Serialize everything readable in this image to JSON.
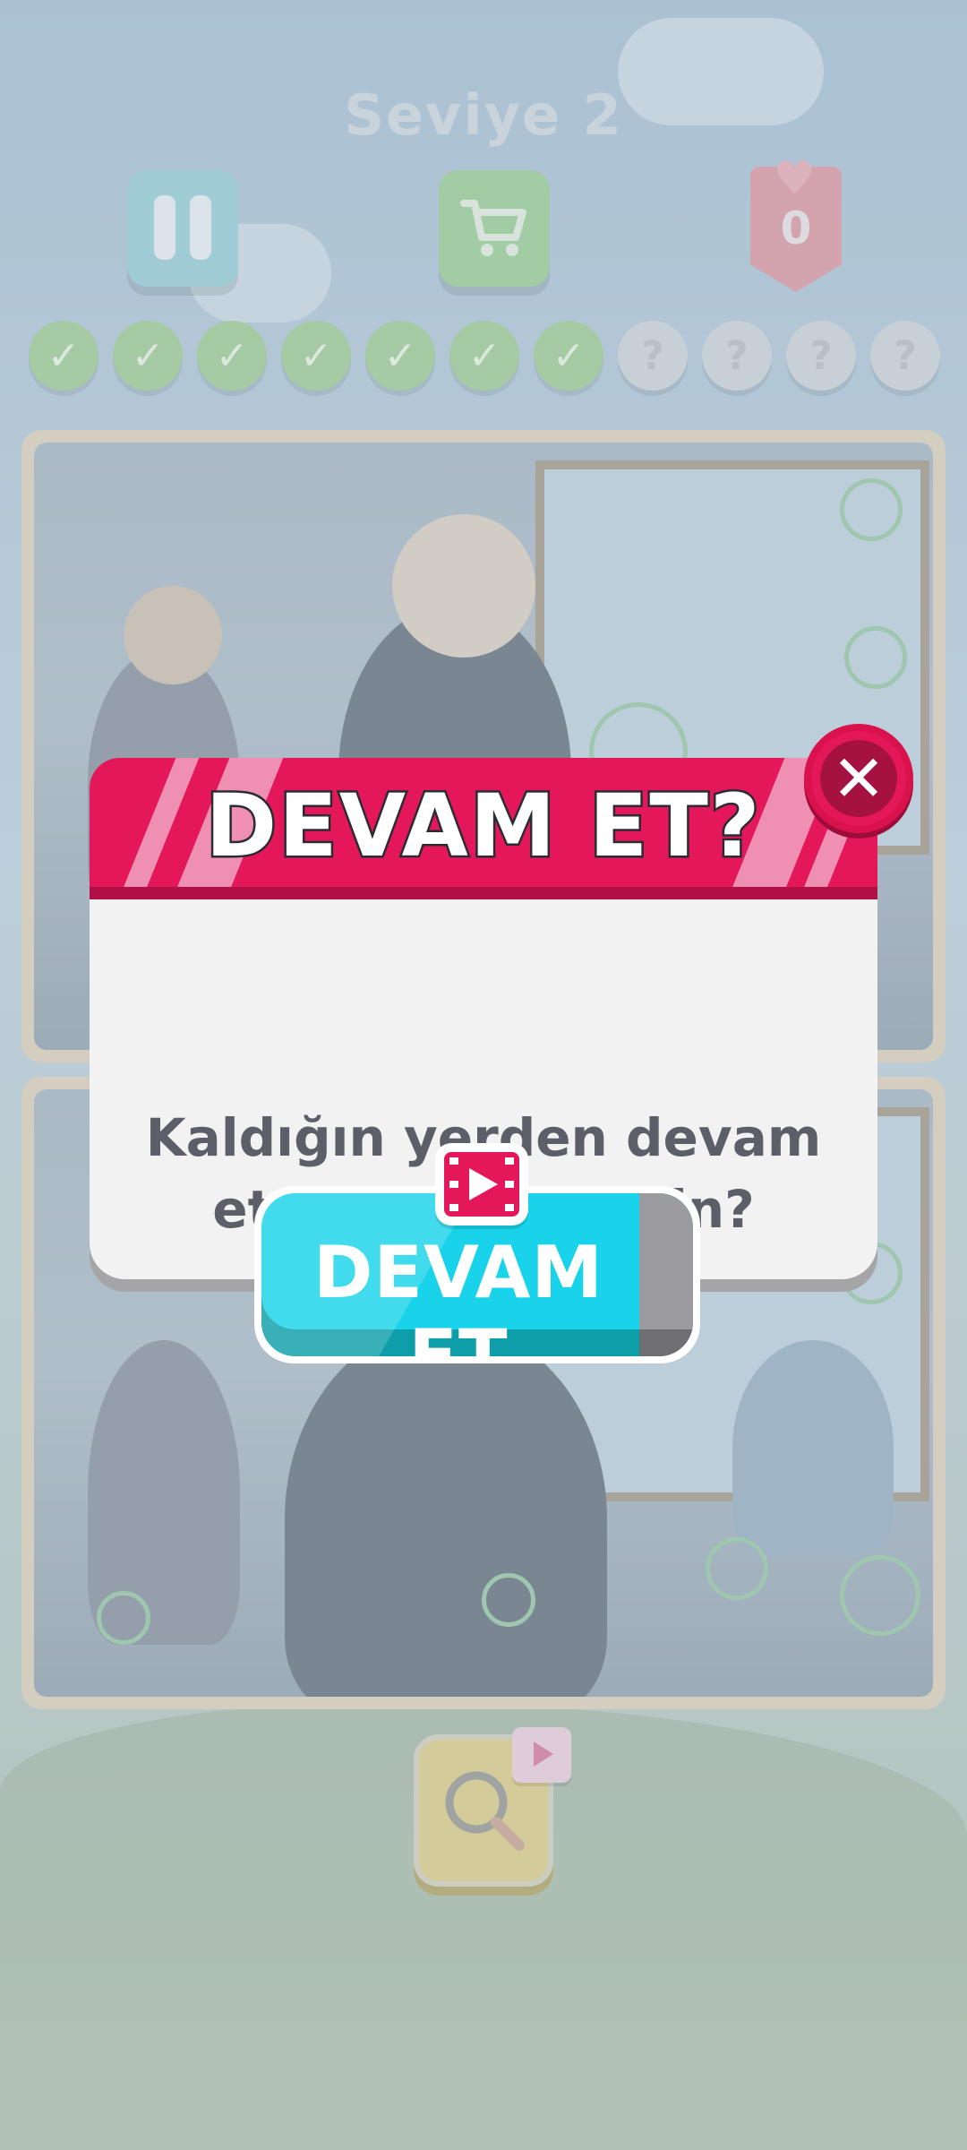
{
  "header": {
    "level_title": "Seviye  2"
  },
  "top_bar": {
    "lives_count": "0"
  },
  "progress": {
    "found": 7,
    "total": 11,
    "done_symbol": "✓",
    "todo_symbol": "?"
  },
  "dialog": {
    "title": "DEVAM ET?",
    "message_line1": "Kaldığın yerden devam",
    "message_line2": "etmek ister misin?",
    "close_symbol": "✕",
    "continue_label": "DEVAM ET"
  },
  "colors": {
    "dialog_header": "#e4175a",
    "continue_button": "#18d3e9",
    "progress_done": "#98c489",
    "progress_todo": "#c7cdd2"
  }
}
